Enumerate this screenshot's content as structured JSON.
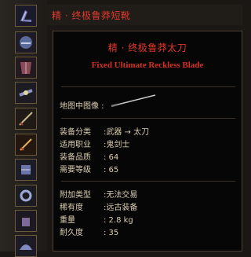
{
  "list": {
    "top_item_label": "精 · 终极鲁莽短靴"
  },
  "tooltip": {
    "title": "精 · 终极鲁莽太刀",
    "subtitle": "Fixed Ultimate Reckless Blade",
    "preview_label": "地图中图像 :",
    "stats": [
      {
        "key": "装备分类",
        "value": ":武器 → 太刀"
      },
      {
        "key": "适用职业",
        "value": ":鬼剑士"
      },
      {
        "key": "装备品质",
        "value": ": 64"
      },
      {
        "key": "需要等级",
        "value": ": 65"
      }
    ],
    "extra": [
      {
        "key": "附加类型",
        "value": ":无法交易"
      },
      {
        "key": "稀有度",
        "value": ":远古装备"
      },
      {
        "key": "重量",
        "value": ": 2.8 kg"
      },
      {
        "key": "耐久度",
        "value": ": 35"
      }
    ]
  },
  "icons": [
    "boots-icon",
    "helmet-icon",
    "armor-icon",
    "belt-icon",
    "blade-icon",
    "blade-icon",
    "bracer-icon",
    "ring-icon",
    "gloves-icon",
    "pauldron-icon",
    "armor-icon"
  ]
}
